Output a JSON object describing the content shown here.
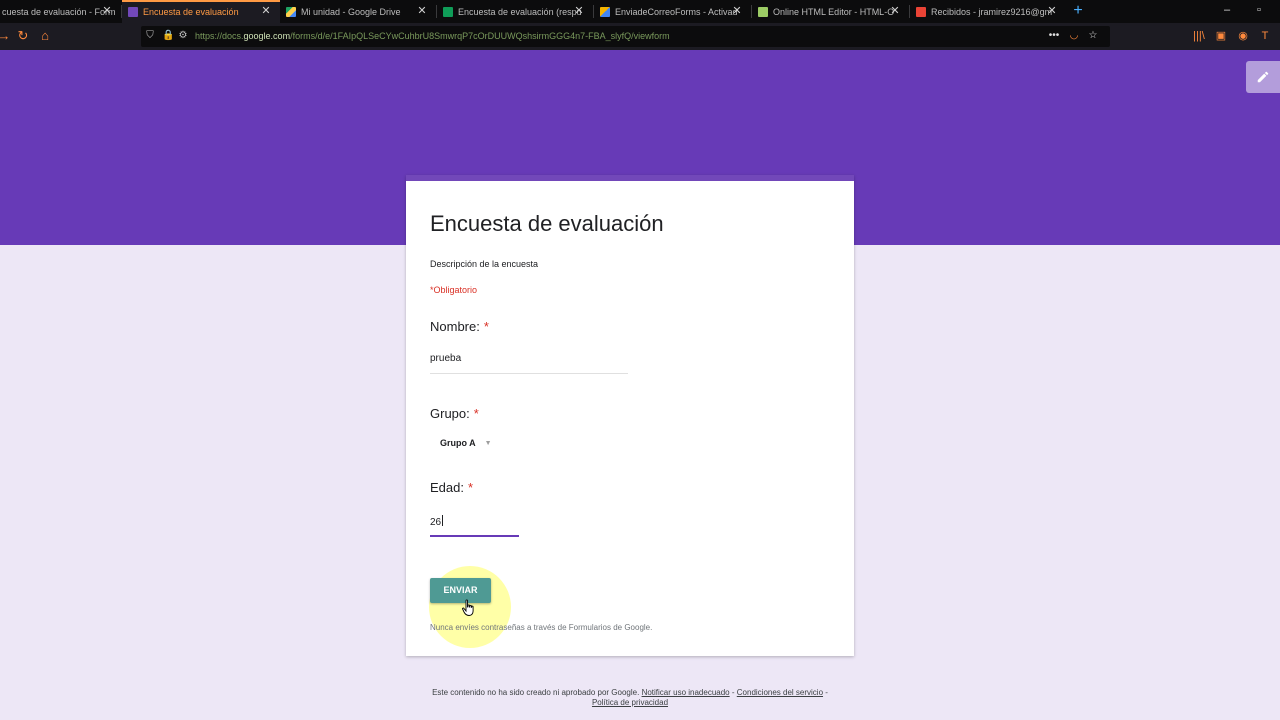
{
  "browser": {
    "tabs": [
      {
        "title": "cuesta de evaluación - Form",
        "icon": "google-forms-icon",
        "active": false,
        "icon_color": "#7248b9"
      },
      {
        "title": "Encuesta de evaluación",
        "icon": "google-forms-icon",
        "active": true,
        "icon_color": "#7248b9"
      },
      {
        "title": "Mi unidad - Google Drive",
        "icon": "google-drive-icon",
        "active": false,
        "icon_color": "#1fa463"
      },
      {
        "title": "Encuesta de evaluación (respu",
        "icon": "google-sheets-icon",
        "active": false,
        "icon_color": "#0f9d58"
      },
      {
        "title": "EnviadeCorreoForms - Activad",
        "icon": "apps-script-icon",
        "active": false,
        "icon_color": "#f4b400"
      },
      {
        "title": "Online HTML Editor - HTML-O",
        "icon": "html-editor-icon",
        "active": false,
        "icon_color": "#9ccc65"
      },
      {
        "title": "Recibidos - jramirez9216@gm",
        "icon": "gmail-icon",
        "active": false,
        "icon_color": "#ea4335"
      }
    ],
    "url_prefix": "https://docs.",
    "url_domain": "google.com",
    "url_path": "/forms/d/e/1FAIpQLSeCYwCuhbrU8SmwrqP7cOrDUUWQshsirmGGG4n7-FBA_slyfQ/viewform",
    "accent_color": "#ff8a3d"
  },
  "form": {
    "title": "Encuesta de evaluación",
    "description": "Descripción de la encuesta",
    "required_note": "*Obligatorio",
    "questions": [
      {
        "label": "Nombre:",
        "required_mark": "*",
        "type": "text",
        "value": "prueba"
      },
      {
        "label": "Grupo:",
        "required_mark": "*",
        "type": "dropdown",
        "value": "Grupo A"
      },
      {
        "label": "Edad:",
        "required_mark": "*",
        "type": "text",
        "value": "26"
      }
    ],
    "submit_label": "ENVIAR",
    "password_warning": "Nunca envíes contraseñas a través de Formularios de Google.",
    "theme_color": "#673ab7",
    "background_color": "#ede7f6"
  },
  "footer": {
    "text": "Este contenido no ha sido creado ni aprobado por Google.",
    "link_report": "Notificar uso inadecuado",
    "sep1": "-",
    "link_terms": "Condiciones del servicio",
    "sep2": "-",
    "link_privacy": "Política de privacidad"
  }
}
